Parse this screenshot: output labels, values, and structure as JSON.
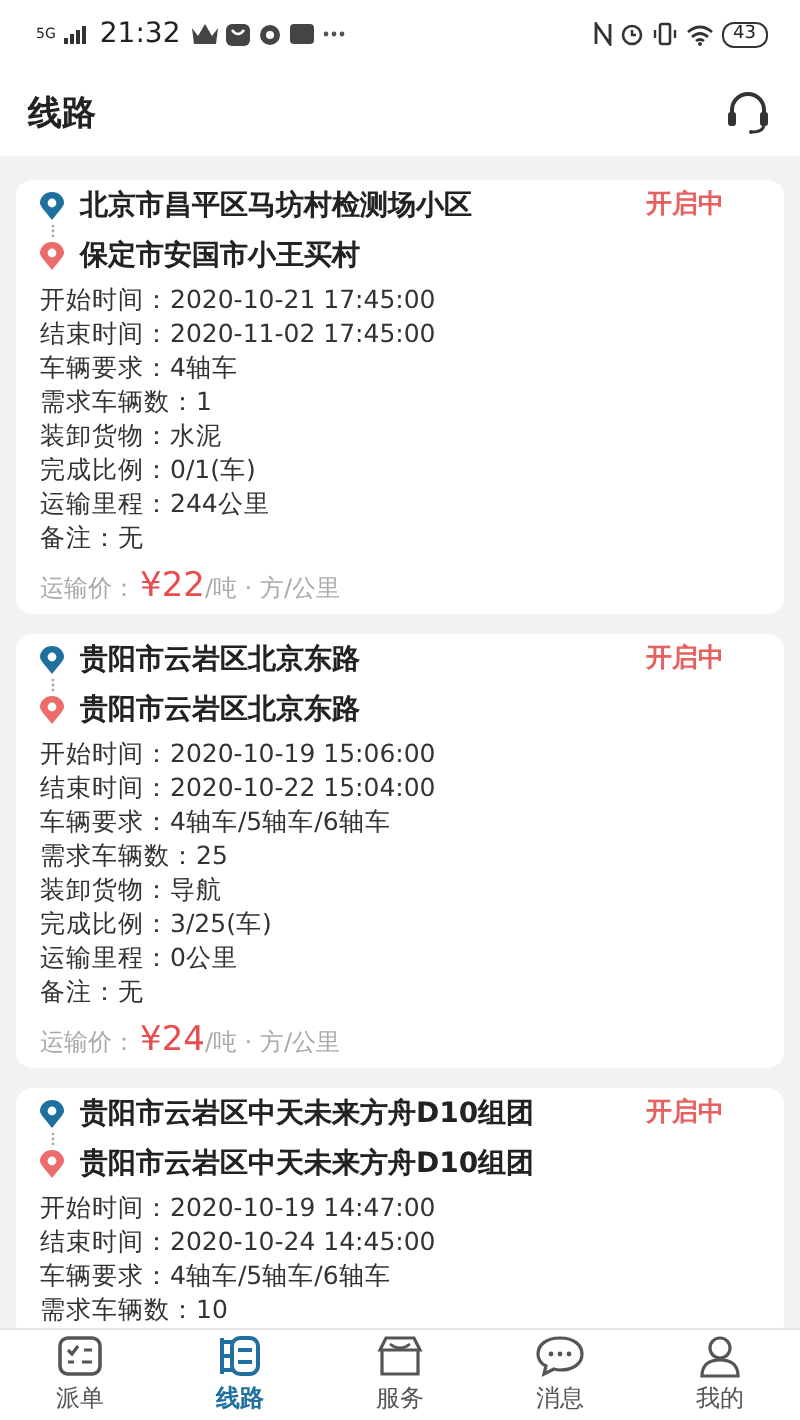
{
  "status_bar": {
    "network": "5G",
    "time": "21:32",
    "battery": "43"
  },
  "header": {
    "title": "线路"
  },
  "routes": [
    {
      "from": "北京市昌平区马坊村检测场小区",
      "to": "保定市安国市小王买村",
      "status": "开启中",
      "fields": [
        {
          "label": "开始时间：",
          "value": "2020-10-21 17:45:00"
        },
        {
          "label": "结束时间：",
          "value": "2020-11-02 17:45:00"
        },
        {
          "label": "车辆要求：",
          "value": "4轴车"
        },
        {
          "label": "需求车辆数：",
          "value": "1"
        },
        {
          "label": "装卸货物：",
          "value": "水泥"
        },
        {
          "label": "完成比例：",
          "value": "0/1(车)"
        },
        {
          "label": "运输里程：",
          "value": "244公里"
        },
        {
          "label": "备注：",
          "value": "无"
        }
      ],
      "price": {
        "label": "运输价：",
        "amount": "¥22",
        "unit": "/吨 · 方/公里"
      }
    },
    {
      "from": "贵阳市云岩区北京东路",
      "to": "贵阳市云岩区北京东路",
      "status": "开启中",
      "fields": [
        {
          "label": "开始时间：",
          "value": "2020-10-19 15:06:00"
        },
        {
          "label": "结束时间：",
          "value": "2020-10-22 15:04:00"
        },
        {
          "label": "车辆要求：",
          "value": "4轴车/5轴车/6轴车"
        },
        {
          "label": "需求车辆数：",
          "value": "25"
        },
        {
          "label": "装卸货物：",
          "value": "导航"
        },
        {
          "label": "完成比例：",
          "value": "3/25(车)"
        },
        {
          "label": "运输里程：",
          "value": "0公里"
        },
        {
          "label": "备注：",
          "value": "无"
        }
      ],
      "price": {
        "label": "运输价：",
        "amount": "¥24",
        "unit": "/吨 · 方/公里"
      }
    },
    {
      "from": "贵阳市云岩区中天未来方舟D10组团",
      "to": "贵阳市云岩区中天未来方舟D10组团",
      "status": "开启中",
      "fields": [
        {
          "label": "开始时间：",
          "value": "2020-10-19 14:47:00"
        },
        {
          "label": "结束时间：",
          "value": "2020-10-24 14:45:00"
        },
        {
          "label": "车辆要求：",
          "value": "4轴车/5轴车/6轴车"
        },
        {
          "label": "需求车辆数：",
          "value": "10"
        }
      ]
    }
  ],
  "tabs": [
    {
      "label": "派单",
      "kind": "orders",
      "selected": false
    },
    {
      "label": "线路",
      "kind": "routes",
      "selected": true
    },
    {
      "label": "服务",
      "kind": "service",
      "selected": false
    },
    {
      "label": "消息",
      "kind": "messages",
      "selected": false
    },
    {
      "label": "我的",
      "kind": "profile",
      "selected": false
    }
  ]
}
